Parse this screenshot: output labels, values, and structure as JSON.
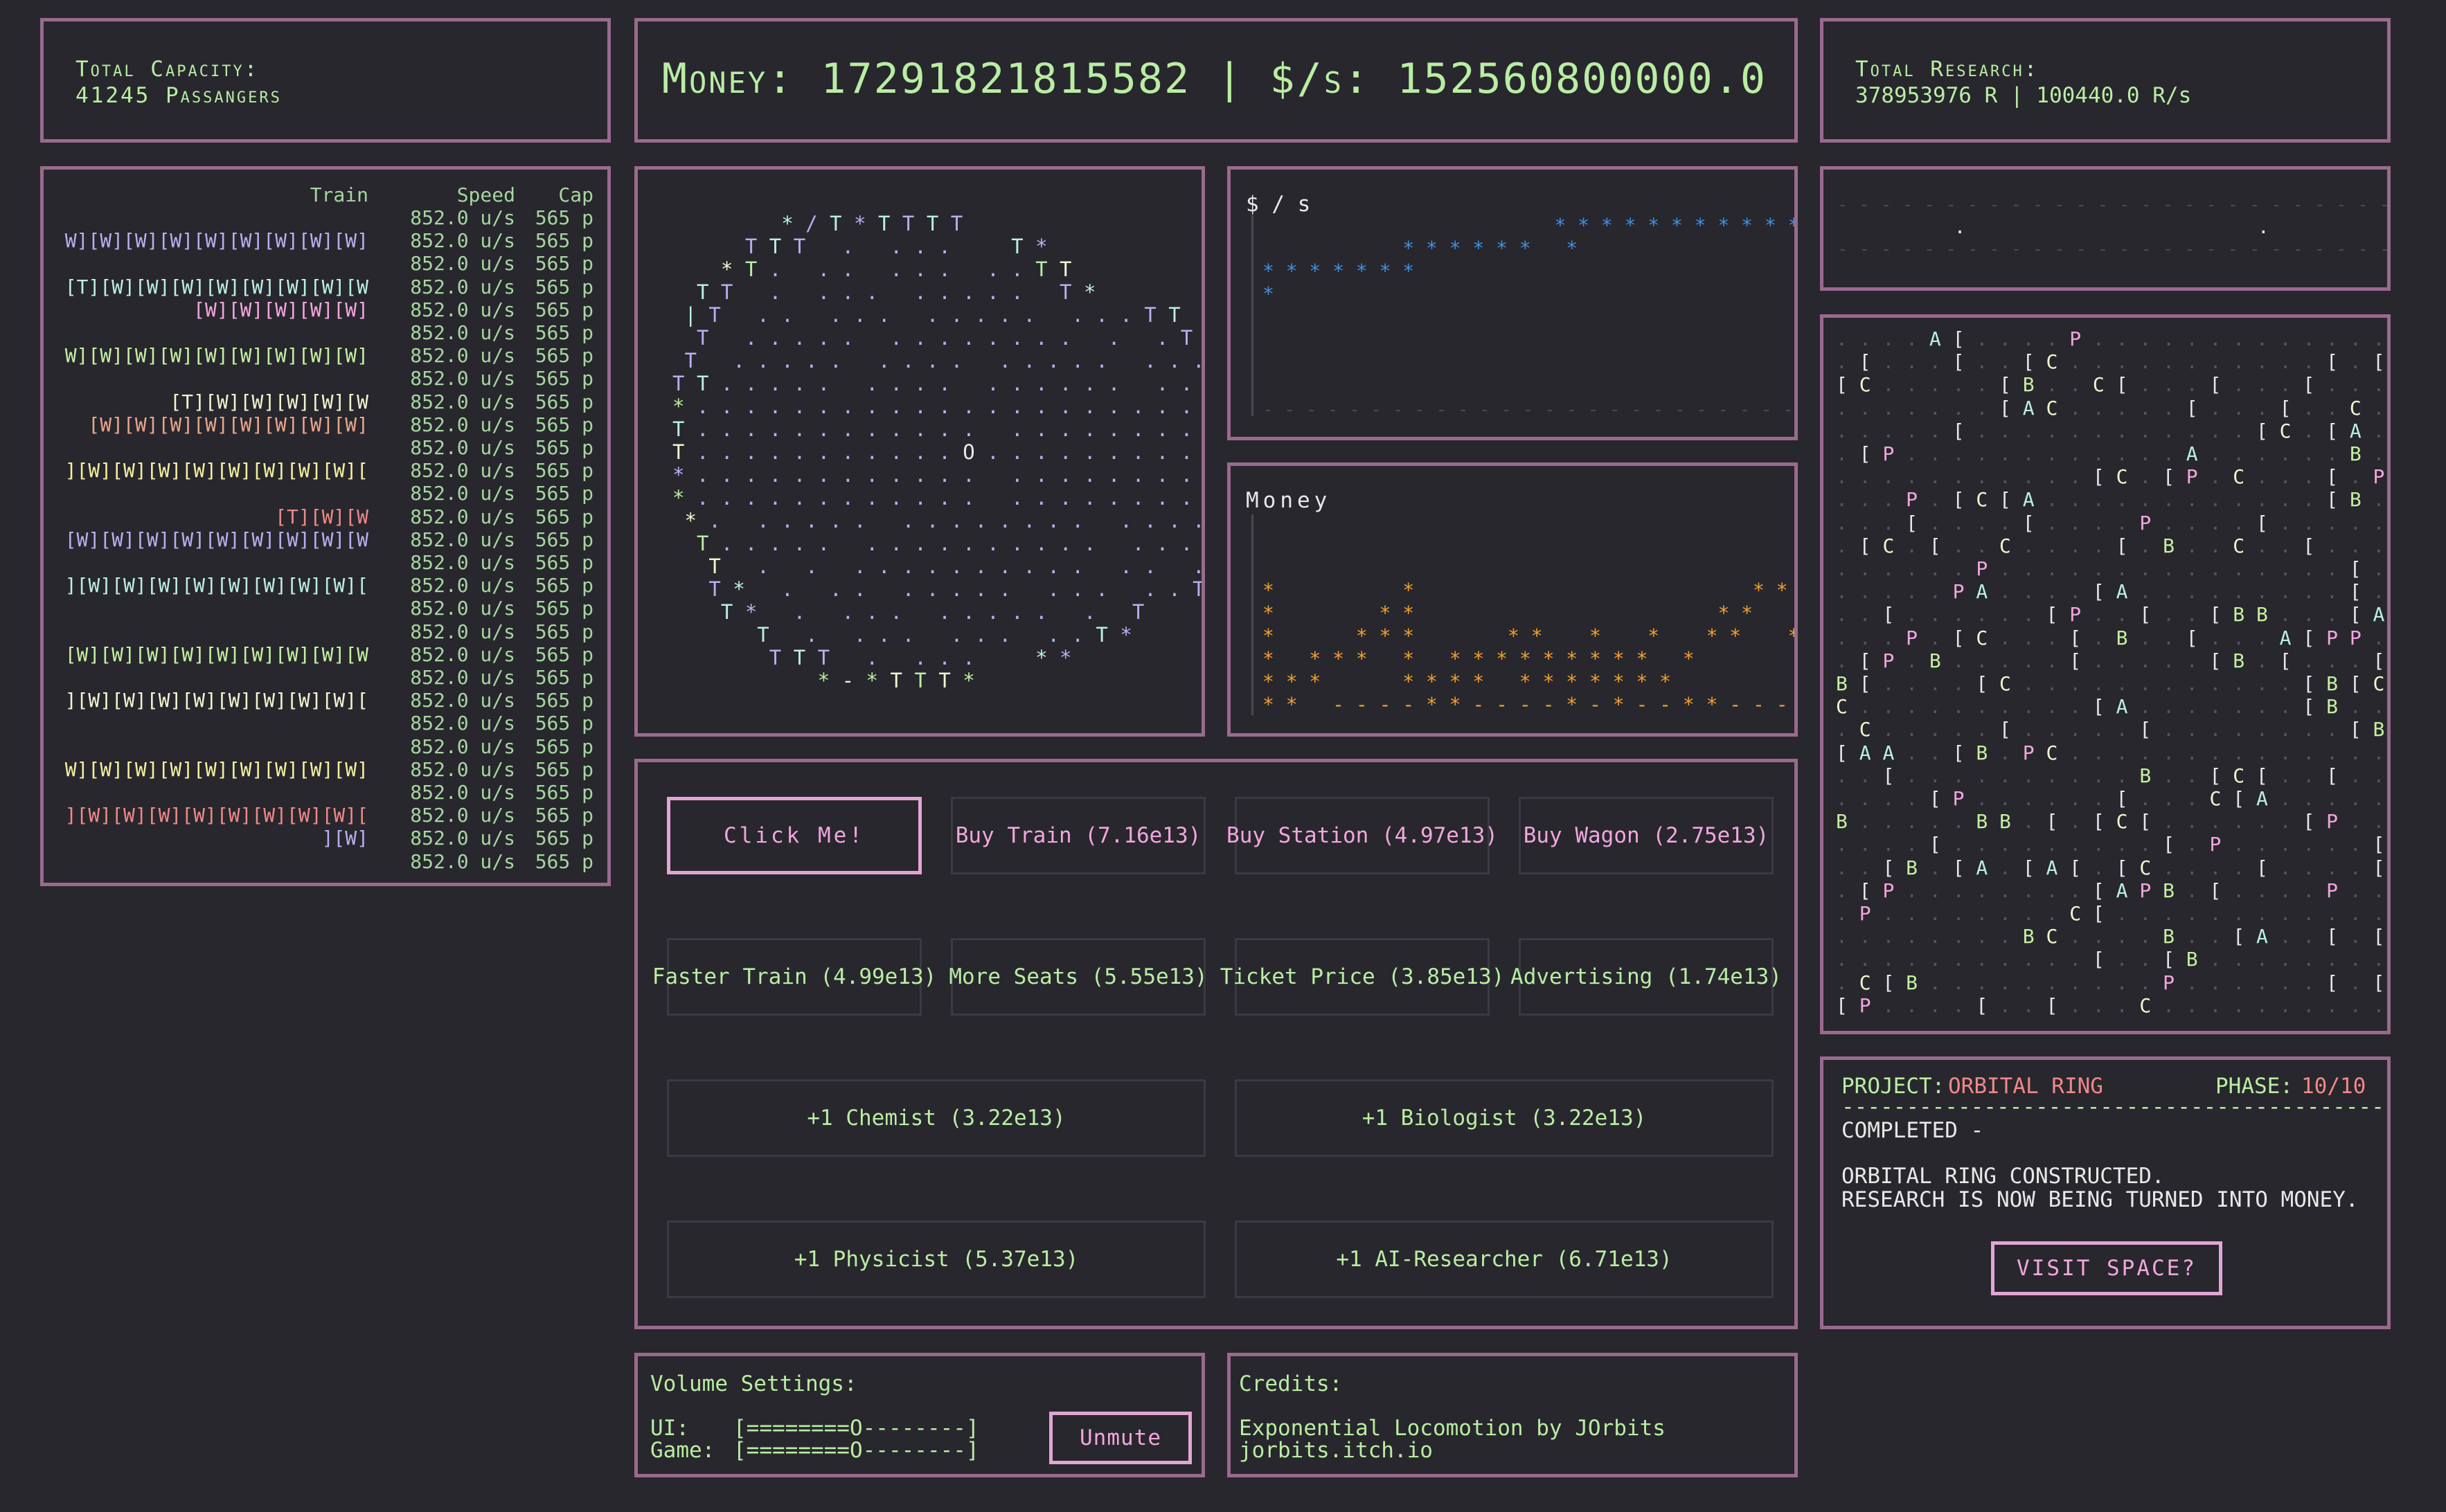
{
  "capacity": {
    "title": "Total Capacity:",
    "value": "41245 Passangers"
  },
  "money": {
    "label": "Money:",
    "amount": "17291821815582",
    "sep": "|",
    "rate_label": "$/s:",
    "rate": "152560800000.0"
  },
  "research": {
    "title": "Total Research:",
    "value": "378953976 R | 100440.0 R/s"
  },
  "trains": {
    "headers": {
      "train": "Train",
      "speed": "Speed",
      "cap": "Cap"
    },
    "rows": [
      {
        "train": "",
        "color": "#b9eda3",
        "speed": "852.0 u/s",
        "cap": "565 p"
      },
      {
        "train": "W][W][W][W][W][W][W][W][W]",
        "color": "#b6b0f0",
        "speed": "852.0 u/s",
        "cap": "565 p"
      },
      {
        "train": "",
        "color": "#b9eda3",
        "speed": "852.0 u/s",
        "cap": "565 p"
      },
      {
        "train": "[T][W][W][W][W][W][W][W][W",
        "color": "#b9f0e0",
        "speed": "852.0 u/s",
        "cap": "565 p"
      },
      {
        "train": "[W][W][W][W][W]",
        "color": "#f2a6df",
        "speed": "852.0 u/s",
        "cap": "565 p"
      },
      {
        "train": "",
        "color": "#b9eda3",
        "speed": "852.0 u/s",
        "cap": "565 p"
      },
      {
        "train": "W][W][W][W][W][W][W][W][W]",
        "color": "#c5f0a0",
        "speed": "852.0 u/s",
        "cap": "565 p"
      },
      {
        "train": "",
        "color": "#b9eda3",
        "speed": "852.0 u/s",
        "cap": "565 p"
      },
      {
        "train": "[T][W][W][W][W][W",
        "color": "#f4f4d0",
        "speed": "852.0 u/s",
        "cap": "565 p"
      },
      {
        "train": "[W][W][W][W][W][W][W][W]",
        "color": "#e8a68a",
        "speed": "852.0 u/s",
        "cap": "565 p"
      },
      {
        "train": "",
        "color": "#b9eda3",
        "speed": "852.0 u/s",
        "cap": "565 p"
      },
      {
        "train": "][W][W][W][W][W][W][W][W][",
        "color": "#f4f0a0",
        "speed": "852.0 u/s",
        "cap": "565 p"
      },
      {
        "train": "",
        "color": "#b9eda3",
        "speed": "852.0 u/s",
        "cap": "565 p"
      },
      {
        "train": "[T][W][W",
        "color": "#f08888",
        "speed": "852.0 u/s",
        "cap": "565 p"
      },
      {
        "train": "[W][W][W][W][W][W][W][W][W",
        "color": "#b6b0f0",
        "speed": "852.0 u/s",
        "cap": "565 p"
      },
      {
        "train": "",
        "color": "#b9eda3",
        "speed": "852.0 u/s",
        "cap": "565 p"
      },
      {
        "train": "][W][W][W][W][W][W][W][W][",
        "color": "#b9f0e0",
        "speed": "852.0 u/s",
        "cap": "565 p"
      },
      {
        "train": "",
        "color": "#b9eda3",
        "speed": "852.0 u/s",
        "cap": "565 p"
      },
      {
        "train": "",
        "color": "#b9eda3",
        "speed": "852.0 u/s",
        "cap": "565 p"
      },
      {
        "train": "[W][W][W][W][W][W][W][W][W",
        "color": "#c5f0a0",
        "speed": "852.0 u/s",
        "cap": "565 p"
      },
      {
        "train": "",
        "color": "#b9eda3",
        "speed": "852.0 u/s",
        "cap": "565 p"
      },
      {
        "train": "][W][W][W][W][W][W][W][W][",
        "color": "#f4f4d0",
        "speed": "852.0 u/s",
        "cap": "565 p"
      },
      {
        "train": "",
        "color": "#b9eda3",
        "speed": "852.0 u/s",
        "cap": "565 p"
      },
      {
        "train": "",
        "color": "#b9eda3",
        "speed": "852.0 u/s",
        "cap": "565 p"
      },
      {
        "train": "W][W][W][W][W][W][W][W][W]",
        "color": "#f4f0a0",
        "speed": "852.0 u/s",
        "cap": "565 p"
      },
      {
        "train": "",
        "color": "#b9eda3",
        "speed": "852.0 u/s",
        "cap": "565 p"
      },
      {
        "train": "][W][W][W][W][W][W][W][W][",
        "color": "#f08888",
        "speed": "852.0 u/s",
        "cap": "565 p"
      },
      {
        "train": "][W]",
        "color": "#b6b0f0",
        "speed": "852.0 u/s",
        "cap": "565 p"
      },
      {
        "train": "",
        "color": "#b9eda3",
        "speed": "852.0 u/s",
        "cap": "565 p"
      }
    ]
  },
  "planet": {
    "lines": [
      "         * / T * T T T T",
      "      T T T   .   . . .     T *",
      "    * T .   . .   . . .   . . T T",
      "  T T   .   . . .   . . . . .   T *",
      " | T   . .   . . .   . . . . .   . . . T T",
      "  T   . . . . .   . . . . . . . .   .   . T",
      " T   . . . . .   . . . .   . . . . .   . . . .   T",
      "T T . . . . .   . . . .   . . . . . .   . . . . . .   T",
      "* . . . . . . . . . . . . . . . . . . . . . . . . . . T",
      "T . . . . . . . . . . . .   . . . . . . . . . . . . . T",
      "T . . . . . . . . . . . O . . . . . . . . . . . . . . T",
      "* . . . . . . . . . . . .   . . . . . . . . . . . . . T",
      "* . . . . . . . . . . . .   . . . . . . . . . . . . . T",
      " * .   . . . . .   . . . . . . . .   . . . . . . . . T *",
      "  T . . . . .   . . . . . . . . . .   . . . .   . . *",
      "   T   .   .   . . . . . . . . . .   . .   . T",
      "   T *   .   . .   . . . . .   . . .   . . T",
      "    T *   .   . . .   . . . . .   .   T",
      "       T   .   . . .   . . .   . . T *",
      "        T T T   .   . . .     * *",
      "            * - * T T T *"
    ],
    "center": "O"
  },
  "dps_chart": {
    "title": "$ / s",
    "rows": [
      "                         * * * * * * * * * * * *",
      "            * * * * * *   *",
      "* * * * * * *",
      "*"
    ],
    "baseline": "- - - - - - - - - - - - - - - - - - - - - - - - - - - -"
  },
  "money_chart": {
    "title": "Money",
    "rows": [
      "                                                  *",
      "                                                * *",
      "                                              * * *",
      "*           *                             * *     *",
      "*         * *                          * *        *",
      "*       * * *        * *    *    *    * *    *    *",
      "*   * * *   *   * * * * * * * * *   *         *",
      "* * *       * * * *   * * * * * * *           *",
      "* *   - - - - * * - - - - * - * - - * * - - - - - - - -"
    ]
  },
  "space_view": {
    "dash_line": "- - - - - - - - - - - - - - - - - - - - - - - - - - - -",
    "dots_line": "          .                         ."
  },
  "research_grid": {
    "rows": [
      ". . . . A [ . . . . P . . . . . . . . . . . . . .",
      ". [ . . . [ . . [ C . . . . . . . . . . . [ . [",
      "[ C . . . . . [ B . . C [ . . . [ . . . [ . . . .",
      ". . . . . . . [ A C . . . . . [ . . . [ . . C . A",
      ". . . . . [ . . . . . . . . . . . . [ C . [ A . .",
      ". [ P . . . . . . . . . . . . A . . . . . . B . [",
      ". . . . . . . . . . . [ C . [ P . C . . . [ . P .",
      ". . . P . [ C [ A . . . . . . . . . . . . [ B . [",
      ". . . [ . . . . [ . . . . P . . . . [ . . . . . .",
      ". [ C . [ . . C . . . . [ . B . . C . . [ . . . A",
      ". . . . . . P . . . . . . . . . . . . . . . [ . .",
      ". . . . . P A . . . . [ A . . . . . . . . . [ . [ A",
      ". . [ . . . . . . [ P . . [ . . [ B B . . . [ A . P",
      ". . . P . [ C . . . [ . B . . [ . . . A [ P P . .",
      ". [ P . B . . . . . [ . . . . . [ B . [ . . . [ . B",
      "B [ . . . . [ C . . . . . . . . . . . . [ B [ C .",
      "C . . . . . . . . . . [ A . . . . . . . [ B . . [ C",
      ". C . . . . . [ . . . . . [ . . . . . . . . [ B A .",
      "[ A A . . [ B . P C . . . . . . . . . . . . . . . .",
      ". . [ . . . . . . . . . . B . . [ C [ . . [ . . [ A",
      ". . . . [ P . . . . . . [ . . . C [ A . . . . . . C",
      "B . . . . . B B . [ . [ C [ . . . . . . [ P . . [ A",
      ". . . . [ . . . . . . . . . [ . P . . . . . . [ . .",
      ". . [ B . [ A . [ A [ . [ C . . . . [ . . . . [ C .",
      ". [ P . . . . . . . . [ A P B . [ . . . . P . . [ P",
      ". P . . . . . . . . C [ . . . . . . . . . . . . P .",
      ". . . . . . . . B C . . . . B . . [ A . . [ . [ . .",
      ". . . . . . . . . . . [ . . [ B . . . . . . . . . .",
      ". C [ B . . . . . . . . . . P . . . . . . [ . [ B .",
      "[ P . . . . [ . . [ . . . C . . . . . . . . . . B ."
    ],
    "colors": {
      "A": "#b9f0e0",
      "B": "#c5f0a0",
      "C": "#f4f4d0",
      "P": "#f2a6df",
      "[": "#e8e8e8",
      ".": "#55555e"
    }
  },
  "buttons": {
    "click_me": "Click Me!",
    "buy_train": "Buy Train (7.16e13)",
    "buy_station": "Buy Station (4.97e13)",
    "buy_wagon": "Buy Wagon (2.75e13)",
    "faster_train": "Faster Train (4.99e13)",
    "more_seats": "More Seats (5.55e13)",
    "ticket_price": "Ticket Price (3.85e13)",
    "advertising": "Advertising (1.74e13)",
    "chemist": "+1 Chemist (3.22e13)",
    "biologist": "+1 Biologist (3.22e13)",
    "physicist": "+1 Physicist (5.37e13)",
    "ai_researcher": "+1 AI-Researcher (6.71e13)"
  },
  "project": {
    "label": "PROJECT:",
    "name": "ORBITAL RING",
    "phase_label": "PHASE:",
    "phase": "10/10",
    "divider": "-------------------------------------------",
    "status": "COMPLETED -",
    "line1": "ORBITAL RING CONSTRUCTED.",
    "line2": "RESEARCH IS NOW BEING TURNED INTO MONEY.",
    "visit_button": "VISIT SPACE?"
  },
  "volume": {
    "title": "Volume Settings:",
    "ui_label": "UI:",
    "ui_slider": "[========O--------]",
    "game_label": "Game:",
    "game_slider": "[========O--------]",
    "unmute_button": "Unmute"
  },
  "credits": {
    "title": "Credits:",
    "line1": "Exponential Locomotion by JOrbits",
    "line2": "jorbits.itch.io"
  },
  "colors": {
    "background": "#28272d",
    "border": "#9a6a8e",
    "text_green": "#b9eda3",
    "accent_pink": "#f2a6df",
    "chart_blue": "#3f90e0",
    "chart_orange": "#f0a030",
    "project_red": "#f08888"
  }
}
